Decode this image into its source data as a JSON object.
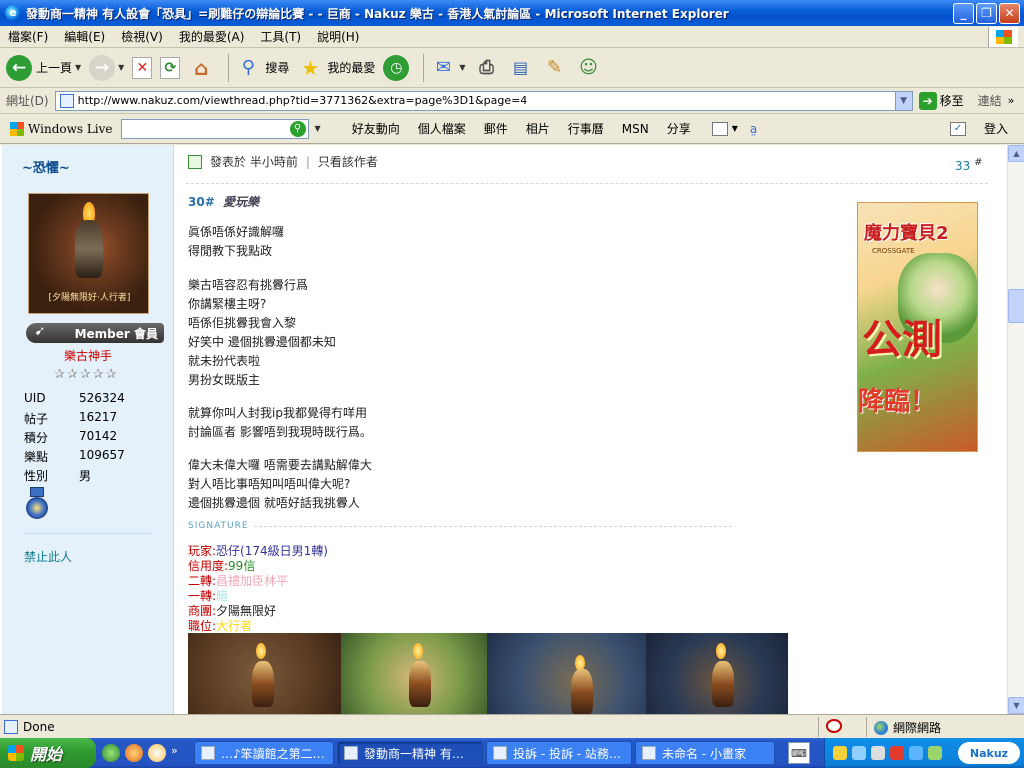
{
  "window": {
    "title": "發動商一精神 有人設會「恐具」=刷難仔の辯論比賽 - - 巨商 - Nakuz 樂古 - 香港人氣討論區 - Microsoft Internet Explorer"
  },
  "menu": [
    "檔案(F)",
    "編輯(E)",
    "檢視(V)",
    "我的最愛(A)",
    "工具(T)",
    "說明(H)"
  ],
  "toolbar": {
    "back": "上一頁",
    "search": "搜尋",
    "favorites": "我的最愛"
  },
  "address": {
    "label": "網址(D)",
    "url": "http://www.nakuz.com/viewthread.php?tid=3771362&extra=page%3D1&page=4",
    "go": "移至",
    "links": "連結"
  },
  "live": {
    "brand": "Windows Live",
    "links": [
      "好友動向",
      "個人檔案",
      "郵件",
      "相片",
      "行事曆",
      "MSN",
      "分享"
    ],
    "signin": "登入"
  },
  "profile": {
    "username": "~恐懼~",
    "avatar_caption": "[夕陽無限好·人行者]",
    "member_label": "Member 會員",
    "rank": "樂古神手",
    "stats": [
      {
        "k": "UID",
        "v": "526324"
      },
      {
        "k": "帖子",
        "v": "16217"
      },
      {
        "k": "積分",
        "v": "70142"
      },
      {
        "k": "樂點",
        "v": "109657"
      },
      {
        "k": "性別",
        "v": "男"
      }
    ],
    "ban_link": "禁止此人"
  },
  "post": {
    "posted": "發表於 半小時前",
    "author_only": "只看該作者",
    "floor": "33",
    "floor_mark": "#",
    "quote_floor": "30#",
    "quote_user": "愛玩樂",
    "lines": [
      "眞係唔係好識解囉",
      "得閒教下我點政",
      "樂古唔容忍有挑釁行爲",
      "你講緊樓主呀?",
      "唔係佢挑釁我會入黎",
      "好笑中 邊個挑釁邊個都未知",
      "就未扮代表啦",
      "男扮女既版主",
      "就算你叫人封我ip我都覺得冇咩用",
      "討論區者 影響唔到我現時既行爲。",
      "偉大未偉大囉 唔需要去講點解偉大",
      "對人唔比事唔知叫唔叫偉大呢?",
      "邊個挑釁邊個 就唔好話我挑釁人"
    ]
  },
  "ad": {
    "title": "魔力寶貝2",
    "subtitle": "CROSSGATE",
    "main": "公測",
    "bottom": "降臨！"
  },
  "signature": {
    "label": "SIGNATURE",
    "rows": [
      {
        "k": "玩家:",
        "v": "恐仔(174級日男1轉)",
        "color": "#333399"
      },
      {
        "k": "信用度:",
        "v": "99信",
        "color": "#228b22"
      },
      {
        "k": "二轉:",
        "v": "昌禮加臣林平",
        "color": "#f4a6b8"
      },
      {
        "k": "一轉:",
        "v": "暗",
        "color": "#a8e6e6"
      },
      {
        "k": "商團:",
        "v": "夕陽無限好",
        "color": "#222222"
      },
      {
        "k": "職位:",
        "v": "大行者",
        "color": "#ffd700"
      }
    ]
  },
  "status": {
    "text": "Done",
    "zone": "網際網路"
  },
  "taskbar": {
    "start": "開始",
    "tasks": [
      "…♪笨讀館之第二…",
      "發動商一精神 有…",
      "投訴 - 投訴 - 站務…",
      "未命名 - 小畫家"
    ],
    "tray_brand": "Nakuz"
  },
  "colors": {
    "accent": "#0e4d8f",
    "rank_red": "#cc0000",
    "link_teal": "#0e7f8f",
    "floor_blue": "#1a7ea5"
  }
}
